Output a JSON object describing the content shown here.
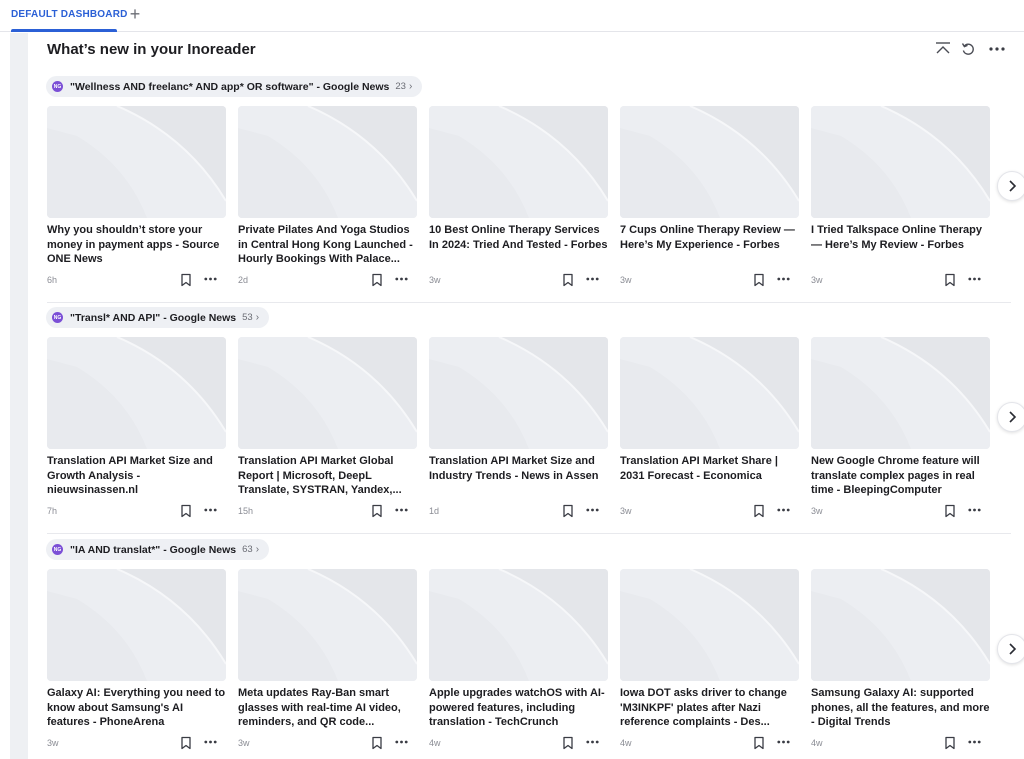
{
  "tabs": {
    "active_label": "DEFAULT DASHBOARD",
    "add_label": "+"
  },
  "widget": {
    "title": "What’s new in your Inoreader"
  },
  "sections": [
    {
      "feed": {
        "avatar": "NG",
        "name": "\"Wellness AND freelanc* AND app* OR software\" - Google News",
        "count": "23"
      },
      "articles": [
        {
          "title": "Why you shouldn’t store your money in payment apps - Source ONE News",
          "age": "6h"
        },
        {
          "title": "Private Pilates And Yoga Studios in Central Hong Kong Launched - Hourly Bookings With Palace...",
          "age": "2d"
        },
        {
          "title": "10 Best Online Therapy Services In 2024: Tried And Tested - Forbes",
          "age": "3w"
        },
        {
          "title": "7 Cups Online Therapy Review — Here’s My Experience - Forbes",
          "age": "3w"
        },
        {
          "title": "I Tried Talkspace Online Therapy — Here’s My Review - Forbes",
          "age": "3w"
        }
      ]
    },
    {
      "feed": {
        "avatar": "NG",
        "name": "\"Transl* AND API\" - Google News",
        "count": "53"
      },
      "articles": [
        {
          "title": "Translation API Market Size and Growth Analysis - nieuwsinassen.nl",
          "age": "7h"
        },
        {
          "title": "Translation API Market Global Report | Microsoft, DeepL Translate, SYSTRAN, Yandex,...",
          "age": "15h"
        },
        {
          "title": "Translation API Market Size and Industry Trends - News in Assen",
          "age": "1d"
        },
        {
          "title": "Translation API Market Share | 2031 Forecast - Economica",
          "age": "3w"
        },
        {
          "title": "New Google Chrome feature will translate complex pages in real time - BleepingComputer",
          "age": "3w"
        }
      ]
    },
    {
      "feed": {
        "avatar": "NG",
        "name": "\"IA AND translat*\" - Google News",
        "count": "63"
      },
      "articles": [
        {
          "title": "Galaxy AI: Everything you need to know about Samsung's AI features - PhoneArena",
          "age": "3w"
        },
        {
          "title": "Meta updates Ray-Ban smart glasses with real-time AI video, reminders, and QR code...",
          "age": "3w"
        },
        {
          "title": "Apple upgrades watchOS with AI-powered features, including translation - TechCrunch",
          "age": "4w"
        },
        {
          "title": "Iowa DOT asks driver to change 'M3INKPF' plates after Nazi reference complaints - Des...",
          "age": "4w"
        },
        {
          "title": "Samsung Galaxy AI: supported phones, all the features, and more - Digital Trends",
          "age": "4w"
        }
      ]
    }
  ],
  "icons": {
    "collapse": "collapse-up-icon",
    "refresh": "refresh-icon",
    "more": "more-horizontal-icon",
    "bookmark": "bookmark-icon",
    "next": "chevron-right-icon",
    "feed_chevron": "chevron-right-icon"
  },
  "colors": {
    "accent": "#2b60d6",
    "feed_avatar": "#7b4fd6",
    "placeholder": "#eceef2"
  }
}
